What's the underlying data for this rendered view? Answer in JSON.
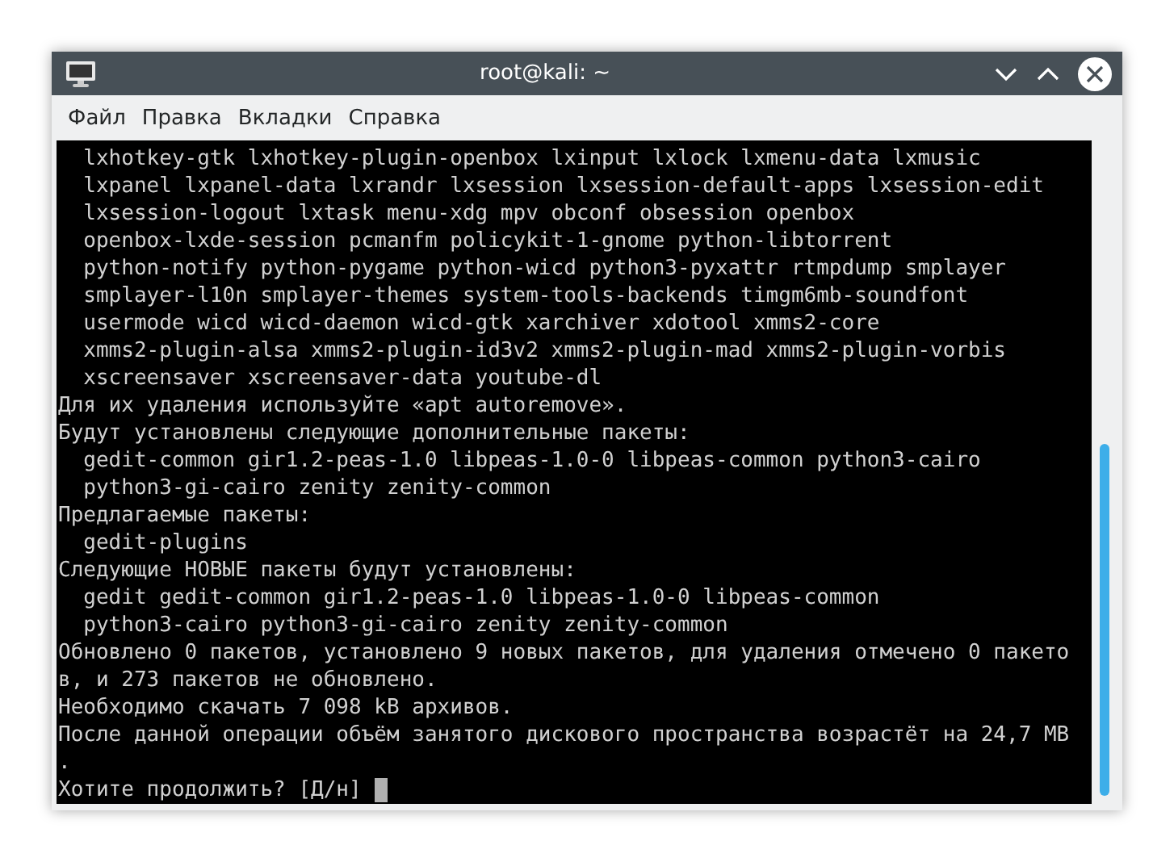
{
  "window": {
    "title": "root@kali: ~"
  },
  "menu": [
    "Файл",
    "Правка",
    "Вкладки",
    "Справка"
  ],
  "terminal": {
    "lines": [
      "  lxhotkey-gtk lxhotkey-plugin-openbox lxinput lxlock lxmenu-data lxmusic",
      "  lxpanel lxpanel-data lxrandr lxsession lxsession-default-apps lxsession-edit",
      "  lxsession-logout lxtask menu-xdg mpv obconf obsession openbox",
      "  openbox-lxde-session pcmanfm policykit-1-gnome python-libtorrent",
      "  python-notify python-pygame python-wicd python3-pyxattr rtmpdump smplayer",
      "  smplayer-l10n smplayer-themes system-tools-backends timgm6mb-soundfont",
      "  usermode wicd wicd-daemon wicd-gtk xarchiver xdotool xmms2-core",
      "  xmms2-plugin-alsa xmms2-plugin-id3v2 xmms2-plugin-mad xmms2-plugin-vorbis",
      "  xscreensaver xscreensaver-data youtube-dl",
      "Для их удаления используйте «apt autoremove».",
      "Будут установлены следующие дополнительные пакеты:",
      "  gedit-common gir1.2-peas-1.0 libpeas-1.0-0 libpeas-common python3-cairo",
      "  python3-gi-cairo zenity zenity-common",
      "Предлагаемые пакеты:",
      "  gedit-plugins",
      "Следующие НОВЫЕ пакеты будут установлены:",
      "  gedit gedit-common gir1.2-peas-1.0 libpeas-1.0-0 libpeas-common",
      "  python3-cairo python3-gi-cairo zenity zenity-common",
      "Обновлено 0 пакетов, установлено 9 новых пакетов, для удаления отмечено 0 пакето",
      "в, и 273 пакетов не обновлено.",
      "Необходимо скачать 7 098 kB архивов.",
      "После данной операции объём занятого дискового пространства возрастёт на 24,7 MB",
      ".",
      "Хотите продолжить? [Д/н] "
    ]
  }
}
